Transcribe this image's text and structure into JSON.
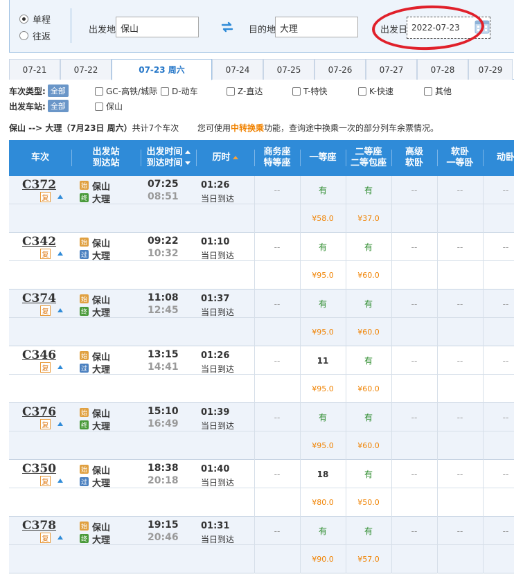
{
  "search": {
    "trip_types": [
      {
        "label": "单程",
        "selected": true
      },
      {
        "label": "往返",
        "selected": false
      }
    ],
    "from_label": "出发地",
    "from_value": "保山",
    "to_label": "目的地",
    "to_value": "大理",
    "date_label": "出发日",
    "date_value": "2022-07-23"
  },
  "date_tabs": [
    "07-21",
    "07-22",
    "07-23 周六",
    "07-24",
    "07-25",
    "07-26",
    "07-27",
    "07-28",
    "07-29"
  ],
  "active_tab": 2,
  "filters": {
    "type_label": "车次类型:",
    "station_label": "出发车站:",
    "all_label": "全部",
    "types": [
      "GC-高铁/城际",
      "D-动车",
      "Z-直达",
      "T-特快",
      "K-快速",
      "其他"
    ],
    "stations": [
      "保山"
    ]
  },
  "summary": {
    "route": "保山 --> 大理（7月23日  周六）",
    "count_text": "共计7个车次",
    "hint_prefix": "您可使用",
    "hint_link": "中转换乘",
    "hint_suffix": "功能，查询途中换乘一次的部分列车余票情况。"
  },
  "table_header": {
    "train": "车次",
    "station_1": "出发站",
    "station_2": "到达站",
    "time_1": "出发时间",
    "time_2": "到达时间",
    "duration": "历时",
    "business_1": "商务座",
    "business_2": "特等座",
    "first": "一等座",
    "second_1": "二等座",
    "second_2": "二等包座",
    "deluxe_1": "高级",
    "deluxe_2": "软卧",
    "soft_1": "软卧",
    "soft_2": "一等卧",
    "emu": "动卧"
  },
  "rows": [
    {
      "train": "C372",
      "fu": "复",
      "from_tag": "始",
      "from": "保山",
      "to_tag": "终",
      "to": "大理",
      "dep": "07:25",
      "arr": "08:51",
      "dur": "01:26",
      "note": "当日到达",
      "business": "--",
      "first": "有",
      "second": "有",
      "deluxe": "--",
      "soft": "--",
      "emu": "--",
      "price_first": "¥58.0",
      "price_second": "¥37.0"
    },
    {
      "train": "C342",
      "fu": "复",
      "from_tag": "始",
      "from": "保山",
      "to_tag": "过",
      "to": "大理",
      "dep": "09:22",
      "arr": "10:32",
      "dur": "01:10",
      "note": "当日到达",
      "business": "--",
      "first": "有",
      "second": "有",
      "deluxe": "--",
      "soft": "--",
      "emu": "--",
      "price_first": "¥95.0",
      "price_second": "¥60.0"
    },
    {
      "train": "C374",
      "fu": "复",
      "from_tag": "始",
      "from": "保山",
      "to_tag": "终",
      "to": "大理",
      "dep": "11:08",
      "arr": "12:45",
      "dur": "01:37",
      "note": "当日到达",
      "business": "--",
      "first": "有",
      "second": "有",
      "deluxe": "--",
      "soft": "--",
      "emu": "--",
      "price_first": "¥95.0",
      "price_second": "¥60.0"
    },
    {
      "train": "C346",
      "fu": "复",
      "from_tag": "始",
      "from": "保山",
      "to_tag": "过",
      "to": "大理",
      "dep": "13:15",
      "arr": "14:41",
      "dur": "01:26",
      "note": "当日到达",
      "business": "--",
      "first": "11",
      "second": "有",
      "deluxe": "--",
      "soft": "--",
      "emu": "--",
      "price_first": "¥95.0",
      "price_second": "¥60.0"
    },
    {
      "train": "C376",
      "fu": "复",
      "from_tag": "始",
      "from": "保山",
      "to_tag": "终",
      "to": "大理",
      "dep": "15:10",
      "arr": "16:49",
      "dur": "01:39",
      "note": "当日到达",
      "business": "--",
      "first": "有",
      "second": "有",
      "deluxe": "--",
      "soft": "--",
      "emu": "--",
      "price_first": "¥95.0",
      "price_second": "¥60.0"
    },
    {
      "train": "C350",
      "fu": "复",
      "from_tag": "始",
      "from": "保山",
      "to_tag": "过",
      "to": "大理",
      "dep": "18:38",
      "arr": "20:18",
      "dur": "01:40",
      "note": "当日到达",
      "business": "--",
      "first": "18",
      "second": "有",
      "deluxe": "--",
      "soft": "--",
      "emu": "--",
      "price_first": "¥80.0",
      "price_second": "¥50.0"
    },
    {
      "train": "C378",
      "fu": "复",
      "from_tag": "始",
      "from": "保山",
      "to_tag": "终",
      "to": "大理",
      "dep": "19:15",
      "arr": "20:46",
      "dur": "01:31",
      "note": "当日到达",
      "business": "--",
      "first": "有",
      "second": "有",
      "deluxe": "--",
      "soft": "--",
      "emu": "--",
      "price_first": "¥90.0",
      "price_second": "¥57.0"
    }
  ]
}
